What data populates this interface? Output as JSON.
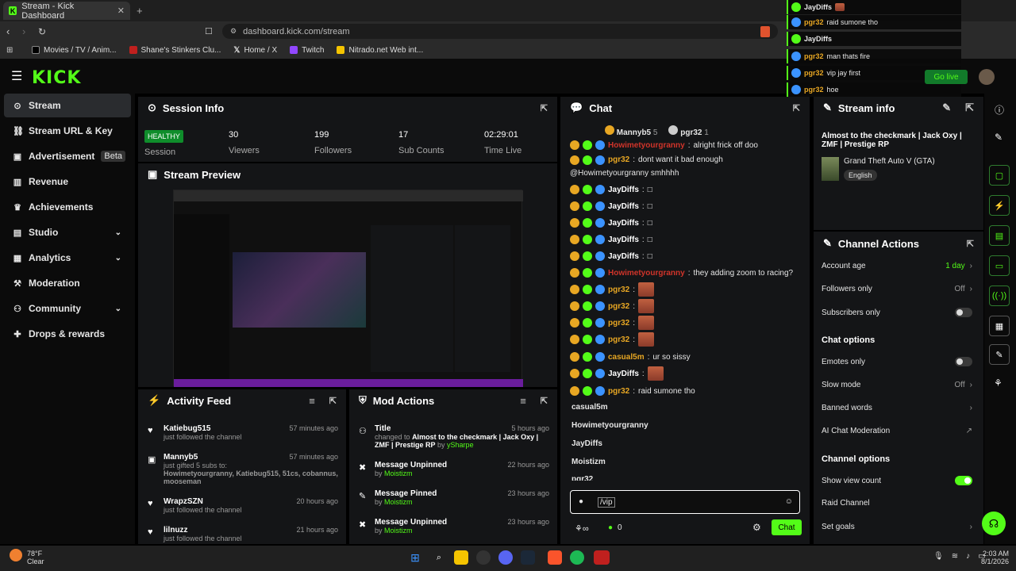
{
  "browser": {
    "tab_title": "Stream - Kick Dashboard",
    "url": "dashboard.kick.com/stream",
    "bookmarks": [
      "Movies / TV / Anim...",
      "Shane's Stinkers Clu...",
      "Home / X",
      "Twitch",
      "Nitrado.net Web int..."
    ]
  },
  "brand": {
    "logo": "KICK",
    "accent": "#53fc18"
  },
  "sidebar": {
    "items": [
      {
        "label": "Stream",
        "icon": "signal-icon"
      },
      {
        "label": "Stream URL & Key",
        "icon": "link-icon"
      },
      {
        "label": "Advertisement",
        "badge": "Beta",
        "icon": "ad-icon"
      },
      {
        "label": "Revenue",
        "icon": "revenue-icon"
      },
      {
        "label": "Achievements",
        "icon": "trophy-icon"
      },
      {
        "label": "Studio",
        "icon": "studio-icon"
      },
      {
        "label": "Analytics",
        "icon": "chart-icon"
      },
      {
        "label": "Moderation",
        "icon": "hammer-icon"
      },
      {
        "label": "Community",
        "icon": "community-icon"
      },
      {
        "label": "Drops & rewards",
        "icon": "gift-icon"
      }
    ]
  },
  "session": {
    "title": "Session Info",
    "status": "HEALTHY",
    "status_label": "Session",
    "stats": [
      {
        "value": "30",
        "label": "Viewers"
      },
      {
        "value": "199",
        "label": "Followers"
      },
      {
        "value": "17",
        "label": "Sub Counts"
      },
      {
        "value": "02:29:01",
        "label": "Time Live"
      }
    ]
  },
  "preview": {
    "title": "Stream Preview"
  },
  "activity": {
    "title": "Activity Feed",
    "items": [
      {
        "name": "Katiebug515",
        "text": "just followed the channel",
        "time": "57 minutes ago"
      },
      {
        "name": "Mannyb5",
        "text": "just gifted 5 subs to:",
        "extra": "Howimetyourgranny, Katiebug515, 51cs, cobannus, mooseman",
        "time": "57 minutes ago"
      },
      {
        "name": "WrapzSZN",
        "text": "just followed the channel",
        "time": "20 hours ago"
      },
      {
        "name": "lilnuzz",
        "text": "just followed the channel",
        "time": "21 hours ago"
      }
    ]
  },
  "mod_actions": {
    "title": "Mod Actions",
    "items": [
      {
        "action": "Title",
        "detail_prefix": "changed to",
        "detail": "Almost to the checkmark | Jack Oxy | ZMF | Prestige RP",
        "by": "ySharpe",
        "time": "5 hours ago"
      },
      {
        "action": "Message Unpinned",
        "by": "Moistizm",
        "time": "22 hours ago"
      },
      {
        "action": "Message Pinned",
        "by": "Moistizm",
        "time": "23 hours ago"
      },
      {
        "action": "Message Unpinned",
        "by": "Moistizm",
        "time": "23 hours ago"
      }
    ]
  },
  "chat": {
    "title": "Chat",
    "top_users": [
      {
        "name": "Mannyb5",
        "count": "5"
      },
      {
        "name": "pgr32",
        "count": "1"
      }
    ],
    "messages": [
      {
        "user": "Howimetyourgranny",
        "text": "alright frick off doo",
        "color": "#d1342a"
      },
      {
        "user": "pgr32",
        "text": "dont want it bad enough",
        "text2": "@Howimetyourgranny smhhhh",
        "color": "#e8a723"
      },
      {
        "user": "JayDiffs",
        "text": "□",
        "color": "#fff"
      },
      {
        "user": "JayDiffs",
        "text": "□",
        "color": "#fff"
      },
      {
        "user": "JayDiffs",
        "text": "□",
        "color": "#fff"
      },
      {
        "user": "JayDiffs",
        "text": "□",
        "color": "#fff"
      },
      {
        "user": "JayDiffs",
        "text": "□",
        "color": "#fff"
      },
      {
        "user": "Howimetyourgranny",
        "text": "they adding zoom to racing?",
        "color": "#d1342a"
      },
      {
        "user": "pgr32",
        "text": "",
        "emote": true,
        "color": "#e8a723"
      },
      {
        "user": "pgr32",
        "text": "",
        "emote": true,
        "color": "#e8a723"
      },
      {
        "user": "pgr32",
        "text": "",
        "emote": true,
        "color": "#e8a723"
      },
      {
        "user": "pgr32",
        "text": "",
        "emote": true,
        "color": "#e8a723"
      },
      {
        "user": "casual5m",
        "text": "ur so sissy",
        "color": "#e8a723"
      },
      {
        "user": "JayDiffs",
        "text": "",
        "emote": true,
        "color": "#fff"
      },
      {
        "user": "pgr32",
        "text": "raid sumone tho",
        "color": "#e8a723"
      }
    ],
    "suggestions": [
      "casual5m",
      "Howimetyourgranny",
      "JayDiffs",
      "Moistizm",
      "pgr32"
    ],
    "input_value": "/vip",
    "points": "0",
    "send_label": "Chat"
  },
  "stream_info": {
    "title": "Stream info",
    "stream_title": "Almost to the checkmark | Jack Oxy | ZMF | Prestige RP",
    "category": "Grand Theft Auto V (GTA)",
    "language": "English"
  },
  "channel_actions": {
    "title": "Channel Actions",
    "account_age_label": "Account age",
    "account_age_value": "1 day",
    "followers_only_label": "Followers only",
    "followers_only_value": "Off",
    "subscribers_only_label": "Subscribers only",
    "chat_options_title": "Chat options",
    "emotes_only_label": "Emotes only",
    "slow_mode_label": "Slow mode",
    "slow_mode_value": "Off",
    "banned_words_label": "Banned words",
    "ai_mod_label": "AI Chat Moderation",
    "channel_options_title": "Channel options",
    "show_view_count_label": "Show view count",
    "raid_label": "Raid Channel",
    "goals_label": "Set goals"
  },
  "overlay": {
    "lines": [
      {
        "user": "JayDiffs",
        "text": ""
      },
      {
        "user": "pgr32",
        "text": "raid sumone tho"
      },
      {
        "user": "JayDiffs",
        "text": ""
      },
      {
        "user": "pgr32",
        "text": "man thats fire"
      },
      {
        "user": "pgr32",
        "text": "vip jay first"
      },
      {
        "user": "pgr32",
        "text": "hoe"
      }
    ],
    "go_live": "Go live"
  },
  "taskbar": {
    "weather_temp": "78°F",
    "weather_desc": "Clear",
    "time": "2:03 AM",
    "date": "8/1/2026"
  }
}
